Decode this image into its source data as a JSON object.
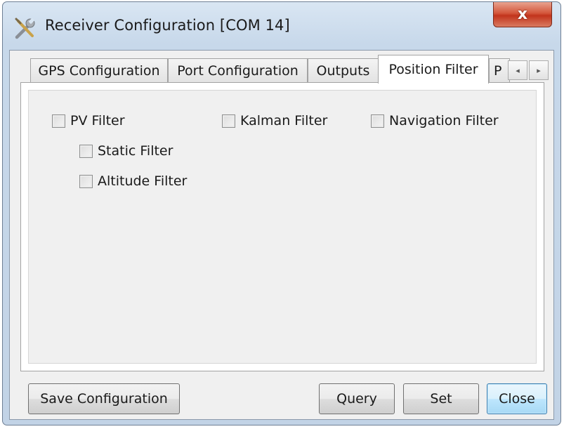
{
  "window": {
    "title": "Receiver Configuration [COM 14]",
    "close_glyph": "x",
    "icon": "tools-icon"
  },
  "tabs": [
    {
      "label": "GPS Configuration"
    },
    {
      "label": "Port Configuration"
    },
    {
      "label": "Outputs"
    },
    {
      "label": "Position Filter",
      "active": true
    },
    {
      "label": "P"
    }
  ],
  "tab_scroller": {
    "left": "◂",
    "right": "▸"
  },
  "filters": {
    "pv": "PV Filter",
    "static": "Static Filter",
    "altitude": "Altitude Filter",
    "kalman": "Kalman Filter",
    "navigation": "Navigation Filter"
  },
  "buttons": {
    "save": "Save Configuration",
    "query": "Query",
    "set": "Set",
    "close": "Close"
  },
  "colors": {
    "close_button": "#c83a22",
    "default_button_border": "#3c7fb1"
  }
}
